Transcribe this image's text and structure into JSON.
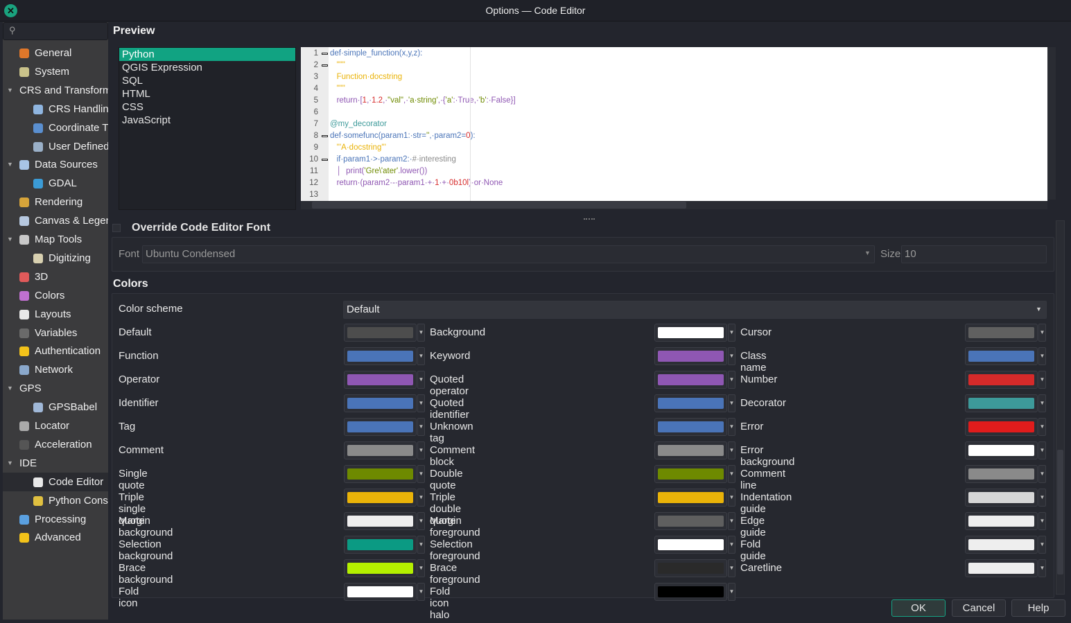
{
  "window": {
    "title": "Options — Code Editor"
  },
  "sidebar": {
    "search_placeholder": "",
    "items": [
      {
        "label": "General",
        "level": 0,
        "expander": false,
        "icon": "hammer-icon",
        "color": "#e0772a"
      },
      {
        "label": "System",
        "level": 0,
        "expander": false,
        "icon": "system-gear-icon",
        "color": "#c9c28a"
      },
      {
        "label": "CRS and Transforms",
        "level": 0,
        "expander": true,
        "icon": "",
        "color": ""
      },
      {
        "label": "CRS Handling",
        "level": 1,
        "expander": false,
        "icon": "globe-icon",
        "color": "#8fb5e0"
      },
      {
        "label": "Coordinate Transforms",
        "level": 1,
        "expander": false,
        "icon": "globe-transform-icon",
        "color": "#5a8fd0"
      },
      {
        "label": "User Defined CRS",
        "level": 1,
        "expander": false,
        "icon": "globe-star-icon",
        "color": "#9ab0c8"
      },
      {
        "label": "Data Sources",
        "level": 0,
        "expander": true,
        "icon": "table-icon",
        "color": "#a8c4e6"
      },
      {
        "label": "GDAL",
        "level": 1,
        "expander": false,
        "icon": "earth-icon",
        "color": "#3b9bd6"
      },
      {
        "label": "Rendering",
        "level": 0,
        "expander": false,
        "icon": "brush-icon",
        "color": "#d6a43a"
      },
      {
        "label": "Canvas & Legend",
        "level": 0,
        "expander": false,
        "icon": "canvas-icon",
        "color": "#b6c8e0"
      },
      {
        "label": "Map Tools",
        "level": 0,
        "expander": true,
        "icon": "map-tools-icon",
        "color": "#c8c8c8"
      },
      {
        "label": "Digitizing",
        "level": 1,
        "expander": false,
        "icon": "digitizing-icon",
        "color": "#d8d0b0"
      },
      {
        "label": "3D",
        "level": 0,
        "expander": false,
        "icon": "cube-icon",
        "color": "#e05a5a"
      },
      {
        "label": "Colors",
        "level": 0,
        "expander": false,
        "icon": "palette-icon",
        "color": "#c070d0"
      },
      {
        "label": "Layouts",
        "level": 0,
        "expander": false,
        "icon": "layout-icon",
        "color": "#e8e8e8"
      },
      {
        "label": "Variables",
        "level": 0,
        "expander": false,
        "icon": "variables-icon",
        "color": "#6a6a6a"
      },
      {
        "label": "Authentication",
        "level": 0,
        "expander": false,
        "icon": "lock-icon",
        "color": "#f2c21a"
      },
      {
        "label": "Network",
        "level": 0,
        "expander": false,
        "icon": "network-icon",
        "color": "#8aa8cc"
      },
      {
        "label": "GPS",
        "level": 0,
        "expander": true,
        "icon": "",
        "color": ""
      },
      {
        "label": "GPSBabel",
        "level": 1,
        "expander": false,
        "icon": "satellite-icon",
        "color": "#a0b8d8"
      },
      {
        "label": "Locator",
        "level": 0,
        "expander": false,
        "icon": "search-icon",
        "color": "#aaaaaa"
      },
      {
        "label": "Acceleration",
        "level": 0,
        "expander": false,
        "icon": "acceleration-icon",
        "color": "#555555"
      },
      {
        "label": "IDE",
        "level": 0,
        "expander": true,
        "icon": "",
        "color": ""
      },
      {
        "label": "Code Editor",
        "level": 1,
        "expander": false,
        "icon": "code-editor-icon",
        "color": "#e8e8e8",
        "selected": true
      },
      {
        "label": "Python Console",
        "level": 1,
        "expander": false,
        "icon": "python-icon",
        "color": "#e0c040"
      },
      {
        "label": "Processing",
        "level": 0,
        "expander": false,
        "icon": "processing-gear-icon",
        "color": "#5aa0e0"
      },
      {
        "label": "Advanced",
        "level": 0,
        "expander": false,
        "icon": "warning-icon",
        "color": "#f2c21a"
      }
    ]
  },
  "preview": {
    "heading": "Preview",
    "languages": [
      "Python",
      "QGIS Expression",
      "SQL",
      "HTML",
      "CSS",
      "JavaScript"
    ],
    "selected_language": "Python",
    "code_lines": [
      {
        "n": "1",
        "fold": true,
        "t": [
          [
            "def",
            "#4a74b8"
          ],
          [
            "·simple_function(x,y,z):",
            "#4a74b8"
          ]
        ]
      },
      {
        "n": "2",
        "fold": true,
        "t": [
          [
            "   \"\"\"",
            "#eab308"
          ]
        ]
      },
      {
        "n": "3",
        "fold": false,
        "t": [
          [
            "   Function·docstring",
            "#eab308"
          ]
        ]
      },
      {
        "n": "4",
        "fold": false,
        "t": [
          [
            "   \"\"\"",
            "#eab308"
          ]
        ]
      },
      {
        "n": "5",
        "fold": false,
        "t": [
          [
            "   return·[",
            "#8f57b3"
          ],
          [
            "1",
            "#d62a2a"
          ],
          [
            ",·",
            "#8f57b3"
          ],
          [
            "1.2",
            "#d62a2a"
          ],
          [
            ",·",
            "#8f57b3"
          ],
          [
            "\"val\"",
            "#6e8a00"
          ],
          [
            ",·",
            "#8f57b3"
          ],
          [
            "'a·string'",
            "#6e8a00"
          ],
          [
            ",·{",
            "#8f57b3"
          ],
          [
            "'a'",
            "#6e8a00"
          ],
          [
            ":·True,·",
            "#8f57b3"
          ],
          [
            "'b'",
            "#6e8a00"
          ],
          [
            ":·False}]",
            "#8f57b3"
          ]
        ]
      },
      {
        "n": "6",
        "fold": false,
        "t": []
      },
      {
        "n": "7",
        "fold": false,
        "t": [
          [
            "@my_decorator",
            "#3d9a9a"
          ]
        ]
      },
      {
        "n": "8",
        "fold": true,
        "t": [
          [
            "def·somefunc(param1:·str=",
            "#4a74b8"
          ],
          [
            "''",
            "#6e8a00"
          ],
          [
            ",·param2=",
            "#4a74b8"
          ],
          [
            "0",
            "#d62a2a"
          ],
          [
            "):",
            "#4a74b8"
          ]
        ]
      },
      {
        "n": "9",
        "fold": false,
        "t": [
          [
            "   '''A·docstring'''",
            "#eab308"
          ]
        ]
      },
      {
        "n": "10",
        "fold": true,
        "t": [
          [
            "   if·param1·>·param2:·",
            "#4a74b8"
          ],
          [
            "#·interesting",
            "#8a8a8a"
          ]
        ]
      },
      {
        "n": "11",
        "fold": false,
        "t": [
          [
            "   │  print(",
            "#8f57b3"
          ],
          [
            "'Gre\\'ater'",
            "#6e8a00"
          ],
          [
            ".lower())",
            "#8f57b3"
          ]
        ]
      },
      {
        "n": "12",
        "fold": false,
        "t": [
          [
            "   return·(param2·-·param1·+·",
            "#8f57b3"
          ],
          [
            "1",
            "#d62a2a"
          ],
          [
            "·+·",
            "#8f57b3"
          ],
          [
            "0b10l",
            "#d62a2a"
          ],
          [
            ")·or·None",
            "#8f57b3"
          ]
        ]
      },
      {
        "n": "13",
        "fold": false,
        "t": []
      }
    ]
  },
  "font": {
    "override_label": "Override Code Editor Font",
    "override_checked": false,
    "font_label": "Font",
    "font_value": "Ubuntu Condensed",
    "size_label": "Size",
    "size_value": "10"
  },
  "colors": {
    "heading": "Colors",
    "scheme_label": "Color scheme",
    "scheme_value": "Default",
    "rows": [
      [
        [
          "Default",
          "#4d4d4d"
        ],
        [
          "Background",
          "#ffffff"
        ],
        [
          "Cursor",
          "#606060"
        ]
      ],
      [
        [
          "Function",
          "#4a74b8"
        ],
        [
          "Keyword",
          "#8f57b3"
        ],
        [
          "Class name",
          "#4a74b8"
        ]
      ],
      [
        [
          "Operator",
          "#8f57b3"
        ],
        [
          "Quoted operator",
          "#8f57b3"
        ],
        [
          "Number",
          "#d62a2a"
        ]
      ],
      [
        [
          "Identifier",
          "#4a74b8"
        ],
        [
          "Quoted identifier",
          "#4a74b8"
        ],
        [
          "Decorator",
          "#3d9a9a"
        ]
      ],
      [
        [
          "Tag",
          "#4a74b8"
        ],
        [
          "Unknown tag",
          "#4a74b8"
        ],
        [
          "Error",
          "#e01c1c"
        ]
      ],
      [
        [
          "Comment",
          "#8a8a8a"
        ],
        [
          "Comment block",
          "#8a8a8a"
        ],
        [
          "Error background",
          "#ffffff"
        ]
      ],
      [
        [
          "Single quote",
          "#6e8a00"
        ],
        [
          "Double quote",
          "#6e8a00"
        ],
        [
          "Comment line",
          "#8a8a8a"
        ]
      ],
      [
        [
          "Triple single quote",
          "#eab308"
        ],
        [
          "Triple double quote",
          "#eab308"
        ],
        [
          "Indentation guide",
          "#d6d6d6"
        ]
      ],
      [
        [
          "Margin background",
          "#eeeeee"
        ],
        [
          "Margin foreground",
          "#5f5f5f"
        ],
        [
          "Edge guide",
          "#eeeeee"
        ]
      ],
      [
        [
          "Selection background",
          "#0b9a83"
        ],
        [
          "Selection foreground",
          "#ffffff"
        ],
        [
          "Fold guide",
          "#eeeeee"
        ]
      ],
      [
        [
          "Brace background",
          "#b4f000"
        ],
        [
          "Brace foreground",
          "#2a2a2a"
        ],
        [
          "Caretline",
          "#eeeeee"
        ]
      ],
      [
        [
          "Fold icon",
          "#ffffff"
        ],
        [
          "Fold icon halo",
          "#000000"
        ],
        null
      ]
    ]
  },
  "buttons": {
    "ok": "OK",
    "cancel": "Cancel",
    "help": "Help"
  }
}
